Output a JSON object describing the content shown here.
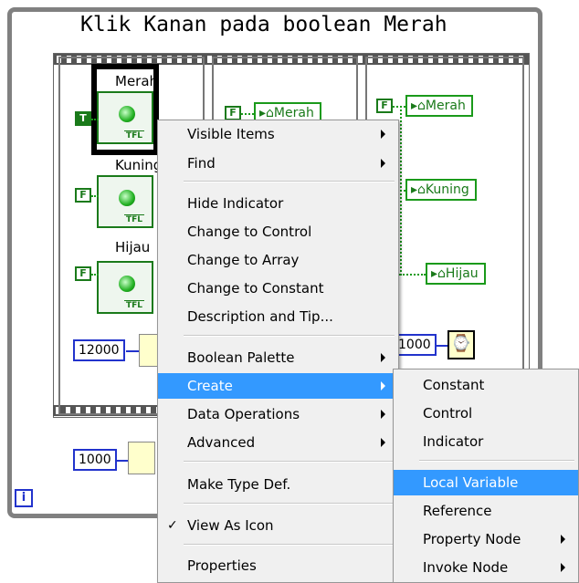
{
  "caption": "Klik Kanan pada boolean Merah",
  "indicators": [
    {
      "label": "Merah",
      "tfl": "TFL",
      "const": "T"
    },
    {
      "label": "Kuning",
      "tfl": "TFL",
      "const": "F"
    },
    {
      "label": "Hijau",
      "tfl": "TFL",
      "const": "F"
    }
  ],
  "frame2": {
    "const": "F",
    "local": "Merah"
  },
  "frame3": {
    "const": "F",
    "locals": [
      "Merah",
      "Kuning",
      "Hijau"
    ],
    "num": "1000"
  },
  "numbers": {
    "wait": "12000",
    "loop": "1000"
  },
  "iteration": "i",
  "context_menu": {
    "items": [
      {
        "label": "Visible Items",
        "submenu": true
      },
      {
        "label": "Find",
        "submenu": true
      },
      {
        "label": "Hide Indicator"
      },
      {
        "label": "Change to Control"
      },
      {
        "label": "Change to Array"
      },
      {
        "label": "Change to Constant"
      },
      {
        "label": "Description and Tip..."
      },
      {
        "label": "Boolean Palette",
        "submenu": true
      },
      {
        "label": "Create",
        "submenu": true,
        "highlighted": true
      },
      {
        "label": "Data Operations",
        "submenu": true
      },
      {
        "label": "Advanced",
        "submenu": true
      },
      {
        "label": "Make Type Def."
      },
      {
        "label": "View As Icon",
        "checked": true
      },
      {
        "label": "Properties"
      }
    ],
    "check_glyph": "✓"
  },
  "create_submenu": {
    "items": [
      {
        "label": "Constant"
      },
      {
        "label": "Control"
      },
      {
        "label": "Indicator"
      },
      {
        "label": "Local Variable",
        "highlighted": true
      },
      {
        "label": "Reference"
      },
      {
        "label": "Property Node",
        "submenu": true
      },
      {
        "label": "Invoke Node",
        "submenu": true
      }
    ]
  },
  "colors": {
    "highlight": "#3399ff",
    "boolean_wire": "#1a9a1a",
    "numeric": "#2233cc"
  }
}
